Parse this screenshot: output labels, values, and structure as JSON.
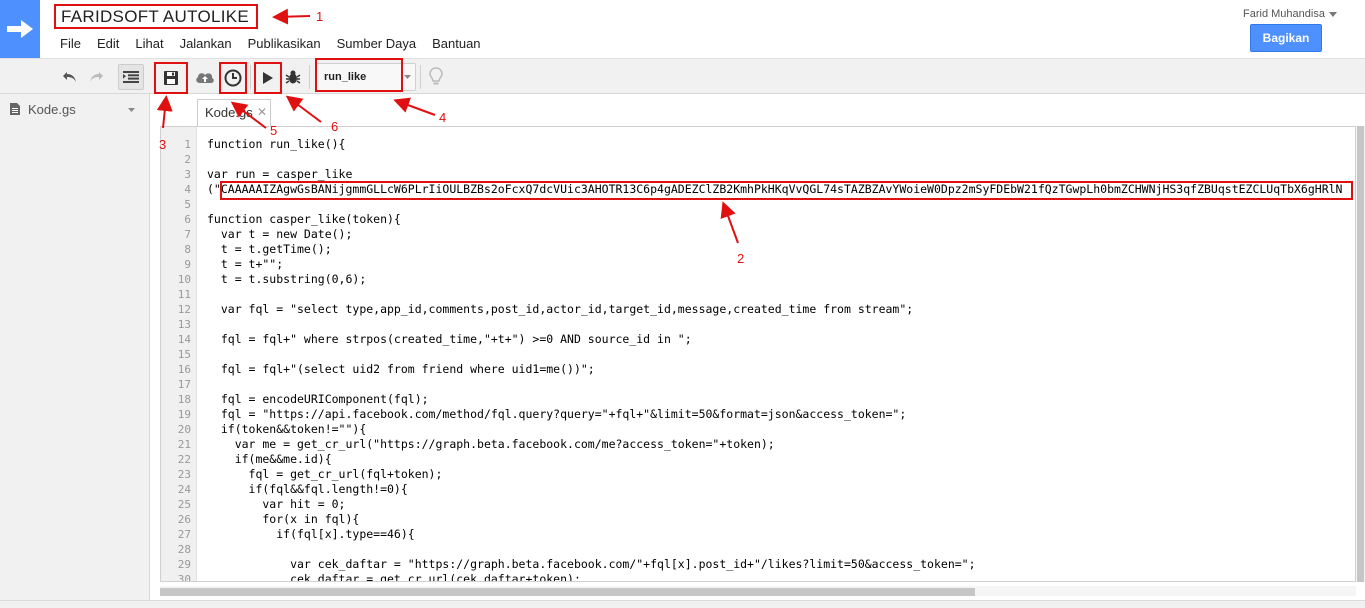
{
  "header": {
    "title": "FARIDSOFT AUTOLIKE",
    "user_name": "Farid Muhandisa",
    "share_label": "Bagikan"
  },
  "menu": [
    "File",
    "Edit",
    "Lihat",
    "Jalankan",
    "Publikasikan",
    "Sumber Daya",
    "Bantuan"
  ],
  "toolbar": {
    "function_select": "run_like"
  },
  "sidebar": {
    "file_name": "Kode.gs"
  },
  "tab": {
    "label": "Kode.gs"
  },
  "annotations": [
    "1",
    "2",
    "3",
    "4",
    "5",
    "6"
  ],
  "code_lines": [
    "function run_like(){",
    "",
    "var run = casper_like",
    "(\"CAAAAAIZAgwGsBANijgmmGLLcW6PLrIiOULBZBs2oFcxQ7dcVUic3AHOTR13C6p4gADEZClZB2KmhPkHKqVvQGL74sTAZBZAvYWoieW0Dpz2mSyFDEbW21fQzTGwpLh0bmZCHWNjHS3qfZBUqstEZCLUqTbX6gHRlN",
    "",
    "function casper_like(token){",
    "  var t = new Date();",
    "  t = t.getTime();",
    "  t = t+\"\";",
    "  t = t.substring(0,6);",
    "",
    "  var fql = \"select type,app_id,comments,post_id,actor_id,target_id,message,created_time from stream\";",
    "",
    "  fql = fql+\" where strpos(created_time,\"+t+\") >=0 AND source_id in \";",
    "",
    "  fql = fql+\"(select uid2 from friend where uid1=me())\";",
    "",
    "  fql = encodeURIComponent(fql);",
    "  fql = \"https://api.facebook.com/method/fql.query?query=\"+fql+\"&limit=50&format=json&access_token=\";",
    "  if(token&&token!=\"\"){",
    "    var me = get_cr_url(\"https://graph.beta.facebook.com/me?access_token=\"+token);",
    "    if(me&&me.id){",
    "      fql = get_cr_url(fql+token);",
    "      if(fql&&fql.length!=0){",
    "        var hit = 0;",
    "        for(x in fql){",
    "          if(fql[x].type==46){",
    "",
    "            var cek_daftar = \"https://graph.beta.facebook.com/\"+fql[x].post_id+\"/likes?limit=50&access_token=\";",
    "            cek_daftar = get_cr_url(cek_daftar+token);"
  ]
}
